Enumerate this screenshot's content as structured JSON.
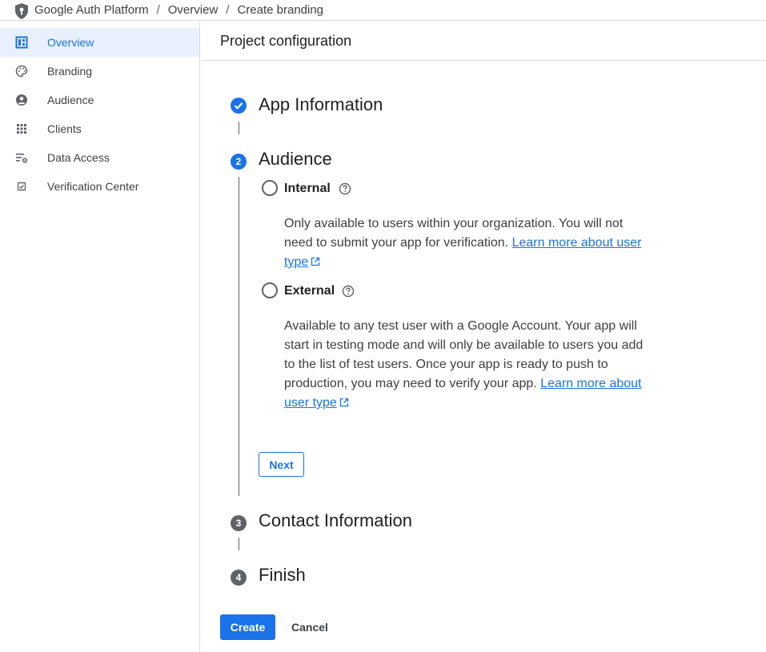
{
  "breadcrumb": {
    "app": "Google Auth Platform",
    "items": [
      "Overview",
      "Create branding"
    ],
    "separator": "/"
  },
  "sidebar": {
    "items": [
      {
        "label": "Overview",
        "icon": "dashboard-icon",
        "active": true
      },
      {
        "label": "Branding",
        "icon": "palette-icon"
      },
      {
        "label": "Audience",
        "icon": "person-icon"
      },
      {
        "label": "Clients",
        "icon": "apps-grid-icon"
      },
      {
        "label": "Data Access",
        "icon": "data-settings-icon"
      },
      {
        "label": "Verification Center",
        "icon": "verification-check-icon"
      }
    ]
  },
  "main": {
    "title": "Project configuration",
    "steps": [
      {
        "number": "1",
        "title": "App Information",
        "state": "completed"
      },
      {
        "number": "2",
        "title": "Audience",
        "state": "active"
      },
      {
        "number": "3",
        "title": "Contact Information",
        "state": "pending"
      },
      {
        "number": "4",
        "title": "Finish",
        "state": "pending"
      }
    ],
    "audience": {
      "options": [
        {
          "label": "Internal",
          "selected": false,
          "description": "Only available to users within your organization. You will not need to submit your app for verification.",
          "link": "Learn more about user type"
        },
        {
          "label": "External",
          "selected": false,
          "description": "Available to any test user with a Google Account. Your app will start in testing mode and will only be available to users you add to the list of test users. Once your app is ready to push to production, you may need to verify your app.",
          "link": "Learn more about user type"
        }
      ],
      "next_label": "Next"
    },
    "create_label": "Create",
    "cancel_label": "Cancel"
  },
  "colors": {
    "accent": "#1a73e8",
    "active_bg": "#e8f0fe",
    "text": "#202124",
    "muted": "#5f6368",
    "border": "#dadce0"
  }
}
